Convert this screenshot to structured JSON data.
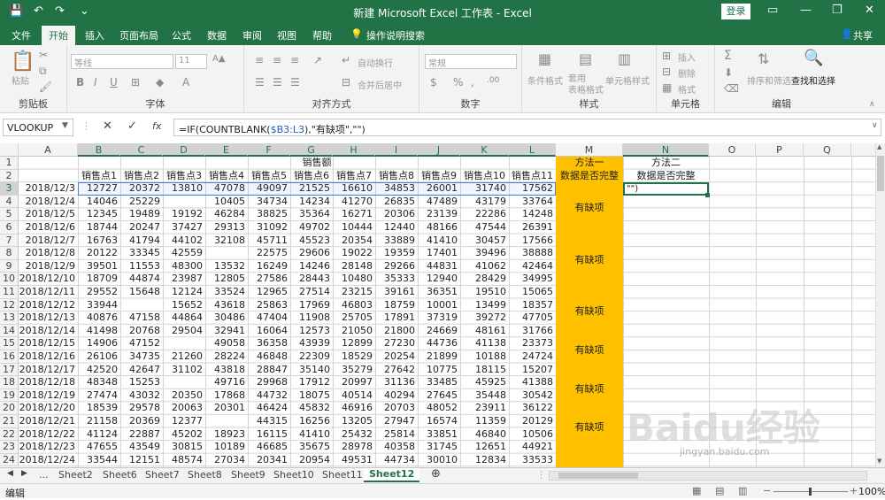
{
  "titlebar": {
    "title": "新建 Microsoft Excel 工作表 - Excel",
    "login": "登录",
    "save_icon": "save-icon",
    "undo_icon": "undo-icon",
    "redo_icon": "redo-icon"
  },
  "tabs": [
    "文件",
    "开始",
    "插入",
    "页面布局",
    "公式",
    "数据",
    "审阅",
    "视图",
    "帮助"
  ],
  "active_tab": "开始",
  "tell_me": "操作说明搜索",
  "share": "共享",
  "ribbon": {
    "clipboard": {
      "paste": "粘贴",
      "label": "剪贴板"
    },
    "font": {
      "name": "等线",
      "size": "11",
      "label": "字体"
    },
    "align": {
      "wrap": "自动换行",
      "merge": "合并后居中",
      "label": "对齐方式"
    },
    "number": {
      "format": "常规",
      "label": "数字"
    },
    "styles": {
      "cond": "条件格式",
      "table": "套用\n表格格式",
      "cell": "单元格样式",
      "label": "样式"
    },
    "cells": {
      "insert": "插入",
      "delete": "删除",
      "format": "格式",
      "label": "单元格"
    },
    "editing": {
      "sort": "排序和筛选",
      "find": "查找和选择",
      "label": "编辑"
    }
  },
  "formula_bar": {
    "name_box": "VLOOKUP",
    "fx": "fx",
    "formula_pre": "=IF(COUNTBLANK(",
    "formula_ref": "$B3:L3",
    "formula_post": "),\"有缺项\",\"\")"
  },
  "columns": [
    "A",
    "B",
    "C",
    "D",
    "E",
    "F",
    "G",
    "H",
    "I",
    "J",
    "K",
    "L",
    "M",
    "N",
    "O",
    "P",
    "Q"
  ],
  "header_row1": "销售额",
  "header_row2": [
    "销售点1",
    "销售点2",
    "销售点3",
    "销售点4",
    "销售点5",
    "销售点6",
    "销售点7",
    "销售点8",
    "销售点9",
    "销售点10",
    "销售点11"
  ],
  "method1": [
    "方法一",
    "数据是否完整"
  ],
  "method2": [
    "方法二",
    "数据是否完整"
  ],
  "editing_cell": "\"\")",
  "rows": [
    [
      "2018/12/3",
      "12727",
      "20372",
      "13810",
      "47078",
      "49097",
      "21525",
      "16610",
      "34853",
      "26001",
      "31740",
      "17562",
      ""
    ],
    [
      "2018/12/4",
      "14046",
      "25229",
      "",
      "10405",
      "34734",
      "14234",
      "41270",
      "26835",
      "47489",
      "43179",
      "33764",
      "有缺项"
    ],
    [
      "2018/12/5",
      "12345",
      "19489",
      "19192",
      "46284",
      "38825",
      "35364",
      "16271",
      "20306",
      "23139",
      "22286",
      "14248",
      ""
    ],
    [
      "2018/12/6",
      "18744",
      "20247",
      "37427",
      "29313",
      "31092",
      "49702",
      "10444",
      "12440",
      "48166",
      "47544",
      "26391",
      ""
    ],
    [
      "2018/12/7",
      "16763",
      "41794",
      "44102",
      "32108",
      "45711",
      "45523",
      "20354",
      "33889",
      "41410",
      "30457",
      "17566",
      ""
    ],
    [
      "2018/12/8",
      "20122",
      "33345",
      "42559",
      "",
      "22575",
      "29606",
      "19022",
      "19359",
      "17401",
      "39496",
      "38888",
      "有缺项"
    ],
    [
      "2018/12/9",
      "39501",
      "11553",
      "48300",
      "13532",
      "16249",
      "14246",
      "28148",
      "29266",
      "44831",
      "41062",
      "42464",
      ""
    ],
    [
      "2018/12/10",
      "18709",
      "44874",
      "23987",
      "12805",
      "27586",
      "28443",
      "10480",
      "35333",
      "12940",
      "28429",
      "34995",
      ""
    ],
    [
      "2018/12/11",
      "29552",
      "15648",
      "12124",
      "33524",
      "12965",
      "27514",
      "23215",
      "39161",
      "36351",
      "19510",
      "15065",
      ""
    ],
    [
      "2018/12/12",
      "33944",
      "",
      "15652",
      "43618",
      "25863",
      "17969",
      "46803",
      "18759",
      "10001",
      "13499",
      "18357",
      "有缺项"
    ],
    [
      "2018/12/13",
      "40876",
      "47158",
      "44864",
      "30486",
      "47404",
      "11908",
      "25705",
      "17891",
      "37319",
      "39272",
      "47705",
      ""
    ],
    [
      "2018/12/14",
      "41498",
      "20768",
      "29504",
      "32941",
      "16064",
      "12573",
      "21050",
      "21800",
      "24669",
      "48161",
      "31766",
      ""
    ],
    [
      "2018/12/15",
      "14906",
      "47152",
      "",
      "49058",
      "36358",
      "43939",
      "12899",
      "27230",
      "44736",
      "41138",
      "23373",
      "有缺项"
    ],
    [
      "2018/12/16",
      "26106",
      "34735",
      "21260",
      "28224",
      "46848",
      "22309",
      "18529",
      "20254",
      "21899",
      "10188",
      "24724",
      ""
    ],
    [
      "2018/12/17",
      "42520",
      "42647",
      "31102",
      "43818",
      "28847",
      "35140",
      "35279",
      "27642",
      "10775",
      "18115",
      "15207",
      ""
    ],
    [
      "2018/12/18",
      "48348",
      "15253",
      "",
      "49716",
      "29968",
      "17912",
      "20997",
      "31136",
      "33485",
      "45925",
      "41388",
      "有缺项"
    ],
    [
      "2018/12/19",
      "27474",
      "43032",
      "20350",
      "17868",
      "44732",
      "18075",
      "40514",
      "40294",
      "27645",
      "35448",
      "30542",
      ""
    ],
    [
      "2018/12/20",
      "18539",
      "29578",
      "20063",
      "20301",
      "46424",
      "45832",
      "46916",
      "20703",
      "48052",
      "23911",
      "36122",
      ""
    ],
    [
      "2018/12/21",
      "21158",
      "20369",
      "12377",
      "",
      "44315",
      "16256",
      "13205",
      "27947",
      "16574",
      "11359",
      "20129",
      "有缺项"
    ],
    [
      "2018/12/22",
      "41124",
      "22887",
      "45202",
      "18923",
      "16115",
      "41410",
      "25432",
      "25814",
      "33851",
      "46840",
      "10506",
      ""
    ],
    [
      "2018/12/23",
      "47655",
      "43549",
      "30815",
      "10189",
      "46685",
      "35675",
      "28978",
      "40358",
      "31745",
      "12651",
      "44921",
      ""
    ],
    [
      "2018/12/24",
      "33544",
      "12151",
      "48574",
      "27034",
      "20341",
      "20954",
      "49531",
      "44734",
      "30010",
      "12834",
      "33533",
      ""
    ]
  ],
  "sheets": [
    "Sheet2",
    "Sheet6",
    "Sheet7",
    "Sheet8",
    "Sheet9",
    "Sheet10",
    "Sheet11",
    "Sheet12"
  ],
  "active_sheet": "Sheet12",
  "status": {
    "mode": "编辑",
    "zoom": "100%"
  },
  "watermark": {
    "text": "Baidu经验",
    "url": "jingyan.baidu.com"
  }
}
